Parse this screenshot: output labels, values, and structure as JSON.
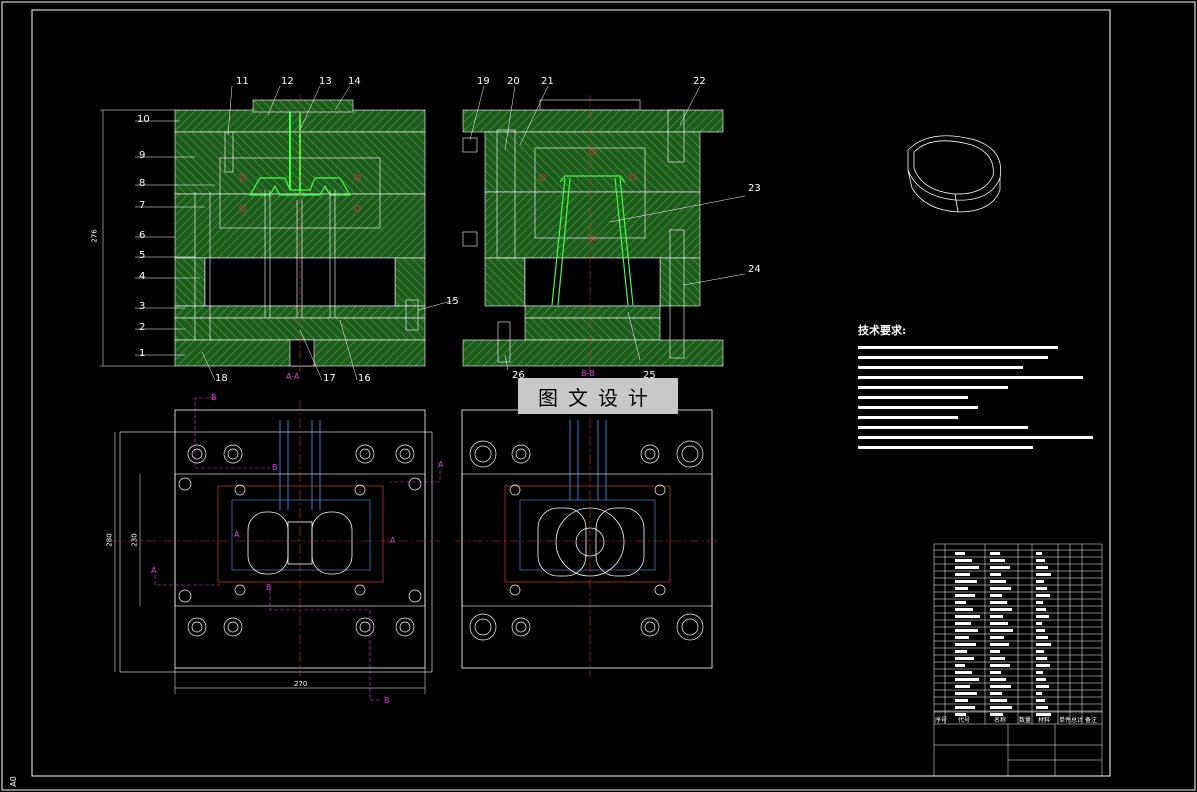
{
  "drawing": {
    "sheet_size": "A0",
    "watermark": "图文设计",
    "tech_requirements_title": "技术要求:",
    "section_labels": [
      "A-A",
      "B-B"
    ],
    "cut_markers": [
      "A",
      "A",
      "A",
      "A",
      "B",
      "B",
      "B",
      "B"
    ],
    "dimensions": {
      "overall_height": "276",
      "plan_height_outer": "280",
      "plan_height_inner": "230",
      "plan_width": "270"
    },
    "part_numbers_left": [
      "10",
      "9",
      "8",
      "7",
      "6",
      "5",
      "4",
      "3",
      "2",
      "1"
    ],
    "part_numbers_top_left": [
      "11",
      "12",
      "13",
      "14"
    ],
    "part_numbers_bottom_left": [
      "18",
      "17",
      "16",
      "15"
    ],
    "part_numbers_right_view": [
      "19",
      "20",
      "21",
      "22",
      "23",
      "24",
      "25",
      "26"
    ],
    "title_block_header": [
      "序号",
      "代号",
      "名称",
      "数量",
      "材料",
      "单件",
      "总计",
      "备注"
    ],
    "colors": {
      "background": "#000000",
      "plate_hatch": "#2e8b2e",
      "frame": "#ffffff",
      "centerline": "#e03030",
      "section_line": "#e040e0",
      "cooling": "#40a0ff",
      "part": "#40ff40"
    }
  }
}
